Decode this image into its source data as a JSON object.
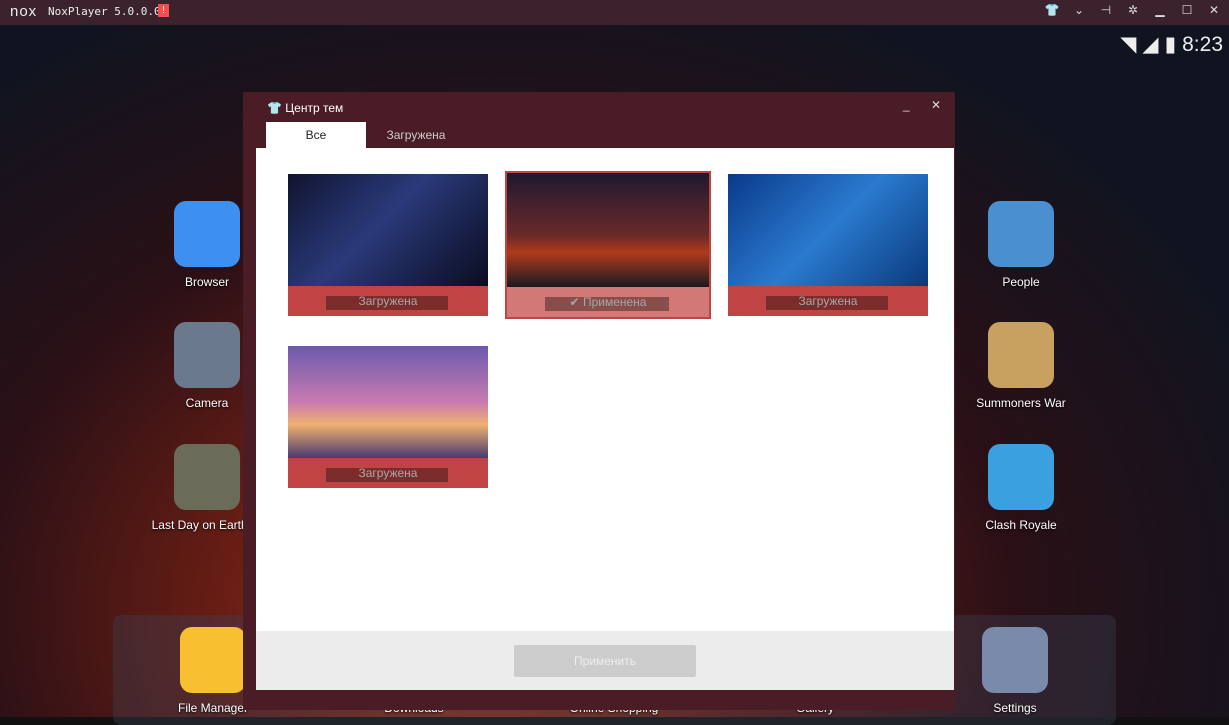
{
  "titlebar": {
    "logo": "nox",
    "title": "NoxPlayer 5.0.0.0",
    "warning": "!",
    "buttons": [
      "theme-icon",
      "chevron-down-icon",
      "pin-icon",
      "gear-icon",
      "minimize-icon",
      "maximize-icon",
      "close-icon"
    ]
  },
  "status": {
    "time": "8:23"
  },
  "desktop": {
    "left": [
      {
        "label": "Browser",
        "color": "#3d8ff0"
      },
      {
        "label": "Camera",
        "color": "#6a7a8c"
      },
      {
        "label": "Last Day on Earth: S",
        "color": "#6b6b5a"
      }
    ],
    "right": [
      {
        "label": "People",
        "color": "#4a90d0"
      },
      {
        "label": "Summoners War",
        "color": "#c8a060"
      },
      {
        "label": "Clash Royale",
        "color": "#3aa0e0"
      }
    ],
    "dock": [
      {
        "label": "File Manager",
        "color": "#f8c030"
      },
      {
        "label": "Downloads"
      },
      {
        "label": "Online Shopping"
      },
      {
        "label": "Gallery"
      },
      {
        "label": "Settings",
        "color": "#7a8aaa"
      }
    ]
  },
  "dialog": {
    "title": "Центр тем",
    "tabs": [
      {
        "label": "Все"
      },
      {
        "label": "Загружена"
      }
    ],
    "themes": [
      {
        "status": "Загружена",
        "applied": false,
        "bg": "linear-gradient(135deg,#101430,#2a3a7a 45%,#0a0c20)"
      },
      {
        "status": "Применена",
        "applied": true,
        "bg": "linear-gradient(180deg,#201830,#6a2a2a 55%,#b03a1a 70%,#1a1a22)"
      },
      {
        "status": "Загружена",
        "applied": false,
        "bg": "linear-gradient(135deg,#0a3a8a,#2a7ad0 50%,#0a3a7a)"
      },
      {
        "status": "Загружена",
        "applied": false,
        "bg": "linear-gradient(180deg,#6a5ab0,#c87ab0 50%,#f0b070 70%,#4a3a70)"
      }
    ],
    "apply_label": "Применить"
  }
}
